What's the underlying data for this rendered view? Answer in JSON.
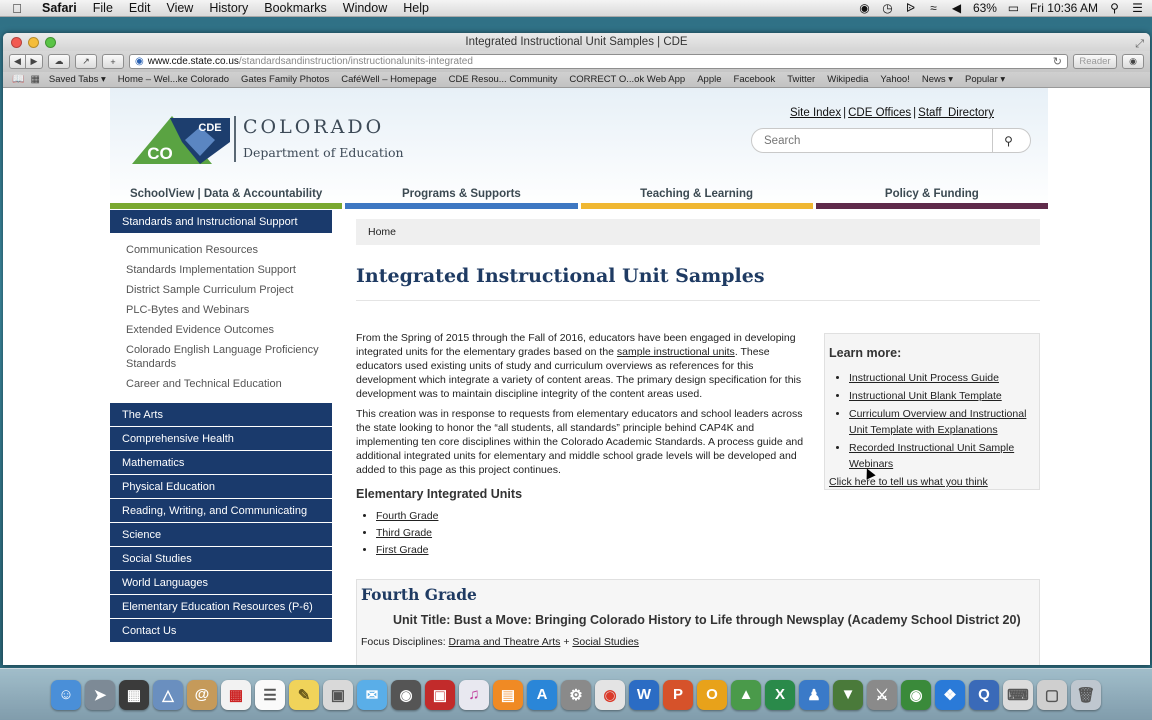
{
  "menubar": {
    "app": "Safari",
    "items": [
      "File",
      "Edit",
      "View",
      "History",
      "Bookmarks",
      "Window",
      "Help"
    ],
    "battery": "63%",
    "clock": "Fri 10:36 AM"
  },
  "window": {
    "title": "Integrated Instructional Unit Samples | CDE",
    "url_host": "www.cde.state.co.us",
    "url_path": "/standardsandinstruction/instructionalunits-integrated",
    "reader_label": "Reader"
  },
  "bookmarks": [
    "Saved Tabs ▾",
    "Home – Wel...ke Colorado",
    "Gates Family Photos",
    "CaféWell – Homepage",
    "CDE Resou... Community",
    "CORRECT O...ok Web App",
    "Apple",
    "Facebook",
    "Twitter",
    "Wikipedia",
    "Yahoo!",
    "News ▾",
    "Popular ▾"
  ],
  "site": {
    "logo_abbrev": "CDE",
    "logo_state_abbrev": "CO",
    "logo_word1": "COLORADO",
    "logo_word2": "Department of Education",
    "toplinks": [
      "Site Index",
      "CDE Offices",
      "Staff  Directory"
    ],
    "search_placeholder": "Search",
    "nav": [
      {
        "label": "SchoolView | Data & Accountability",
        "color": "#7aa82f"
      },
      {
        "label": "Programs & Supports",
        "color": "#3e77c2"
      },
      {
        "label": "Teaching & Learning",
        "color": "#f0b732"
      },
      {
        "label": "Policy & Funding",
        "color": "#5f2a4a"
      }
    ]
  },
  "sidebar": {
    "header": "Standards and Instructional Support",
    "subitems": [
      "Communication Resources",
      "Standards Implementation Support",
      "District Sample Curriculum Project",
      "PLC-Bytes and Webinars",
      "Extended Evidence Outcomes",
      "Colorado English Language Proficiency Standards",
      "Career and Technical Education"
    ],
    "items": [
      "The Arts",
      "Comprehensive Health",
      "Mathematics",
      "Physical Education",
      "Reading, Writing, and Communicating",
      "Science",
      "Social Studies",
      "World Languages",
      "Elementary Education Resources (P-6)",
      "Contact Us"
    ]
  },
  "content": {
    "breadcrumb": "Home",
    "title": "Integrated Instructional Unit Samples",
    "para1_a": "From the Spring of 2015 through the Fall of 2016, educators have been engaged in developing integrated units for the elementary grades based on the ",
    "para1_link": "sample instructional units",
    "para1_b": ". These educators used existing units of study and curriculum overviews as references for this development which integrate a variety of content areas. The primary design specification for this development was to maintain discipline integrity of the content areas used.",
    "para2": "This creation was in response to requests from elementary educators and school leaders across the state looking to honor the “all students, all standards” principle behind CAP4K and implementing ten core disciplines within the Colorado Academic Standards. A process guide and additional integrated units for elementary and middle school grade levels will be developed and added to this page as this project continues.",
    "units_heading": "Elementary Integrated Units",
    "units": [
      "Fourth Grade",
      "Third Grade",
      "First Grade"
    ],
    "learn_more": {
      "heading": "Learn more:",
      "links": [
        "Instructional Unit Process Guide",
        "Instructional Unit Blank Template",
        "Curriculum Overview and Instructional Unit Template with Explanations",
        "Recorded Instructional Unit Sample Webinars"
      ],
      "feedback": "Click here to tell us what you think"
    },
    "fourth": {
      "heading": "Fourth Grade",
      "unit_title": "Unit Title: Bust a Move: Bringing Colorado History to Life through Newsplay (Academy School District 20)",
      "focus_label": "Focus Disciplines: ",
      "focus_1": "Drama and Theatre Arts",
      "focus_sep": " + ",
      "focus_2": "Social Studies"
    }
  }
}
